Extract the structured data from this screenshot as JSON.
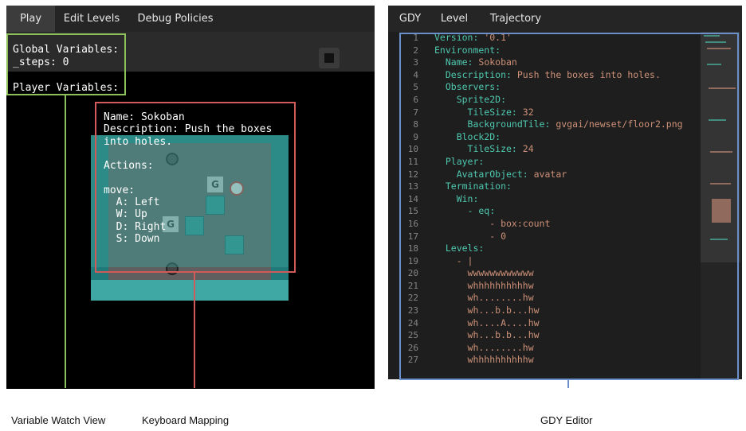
{
  "play_panel": {
    "tabs": [
      {
        "label": "Play",
        "active": true
      },
      {
        "label": "Edit Levels",
        "active": false
      },
      {
        "label": "Debug Policies",
        "active": false
      }
    ],
    "variables_text": "Global Variables:\n_steps: 0\n\nPlayer Variables:",
    "keymap_text": "Name: Sokoban\nDescription: Push the boxes\ninto holes.\n\nActions:\n\nmove:\n  A: Left\n  W: Up\n  D: Right\n  S: Down",
    "stop_icon": "stop-icon"
  },
  "editor_panel": {
    "tabs": [
      {
        "label": "GDY",
        "active": true
      },
      {
        "label": "Level",
        "active": false
      },
      {
        "label": "Trajectory",
        "active": false
      }
    ],
    "lines": [
      {
        "n": "1",
        "key": "Version: ",
        "val": "'0.1'"
      },
      {
        "n": "2",
        "key": "Environment:",
        "val": ""
      },
      {
        "n": "3",
        "key": "  Name: ",
        "val": "Sokoban"
      },
      {
        "n": "4",
        "key": "  Description: ",
        "val": "Push the boxes into holes."
      },
      {
        "n": "5",
        "key": "  Observers:",
        "val": ""
      },
      {
        "n": "6",
        "key": "    Sprite2D:",
        "val": ""
      },
      {
        "n": "7",
        "key": "      TileSize: ",
        "val": "32"
      },
      {
        "n": "8",
        "key": "      BackgroundTile: ",
        "val": "gvgai/newset/floor2.png"
      },
      {
        "n": "9",
        "key": "    Block2D:",
        "val": ""
      },
      {
        "n": "10",
        "key": "      TileSize: ",
        "val": "24"
      },
      {
        "n": "11",
        "key": "  Player:",
        "val": ""
      },
      {
        "n": "12",
        "key": "    AvatarObject: ",
        "val": "avatar"
      },
      {
        "n": "13",
        "key": "  Termination:",
        "val": ""
      },
      {
        "n": "14",
        "key": "    Win:",
        "val": ""
      },
      {
        "n": "15",
        "key": "      - eq:",
        "val": ""
      },
      {
        "n": "16",
        "key": "",
        "val": "          - box:count"
      },
      {
        "n": "17",
        "key": "",
        "val": "          - 0"
      },
      {
        "n": "18",
        "key": "  Levels:",
        "val": ""
      },
      {
        "n": "19",
        "key": "",
        "val": "    - |"
      },
      {
        "n": "20",
        "key": "",
        "val": "      wwwwwwwwwwww"
      },
      {
        "n": "21",
        "key": "",
        "val": "      whhhhhhhhhhw"
      },
      {
        "n": "22",
        "key": "",
        "val": "      wh........hw"
      },
      {
        "n": "23",
        "key": "",
        "val": "      wh...b.b...hw"
      },
      {
        "n": "24",
        "key": "",
        "val": "      wh....A....hw"
      },
      {
        "n": "25",
        "key": "",
        "val": "      wh...b.b...hw"
      },
      {
        "n": "26",
        "key": "",
        "val": "      wh........hw"
      },
      {
        "n": "27",
        "key": "",
        "val": "      whhhhhhhhhhw"
      }
    ]
  },
  "annotations": {
    "variable_watch": {
      "label": "Variable Watch View",
      "color": "#8dbf5a"
    },
    "keyboard_mapping": {
      "label": "Keyboard Mapping",
      "color": "#d15a5a"
    },
    "gdy_editor": {
      "label": "GDY Editor",
      "color": "#6a8fc9"
    }
  }
}
